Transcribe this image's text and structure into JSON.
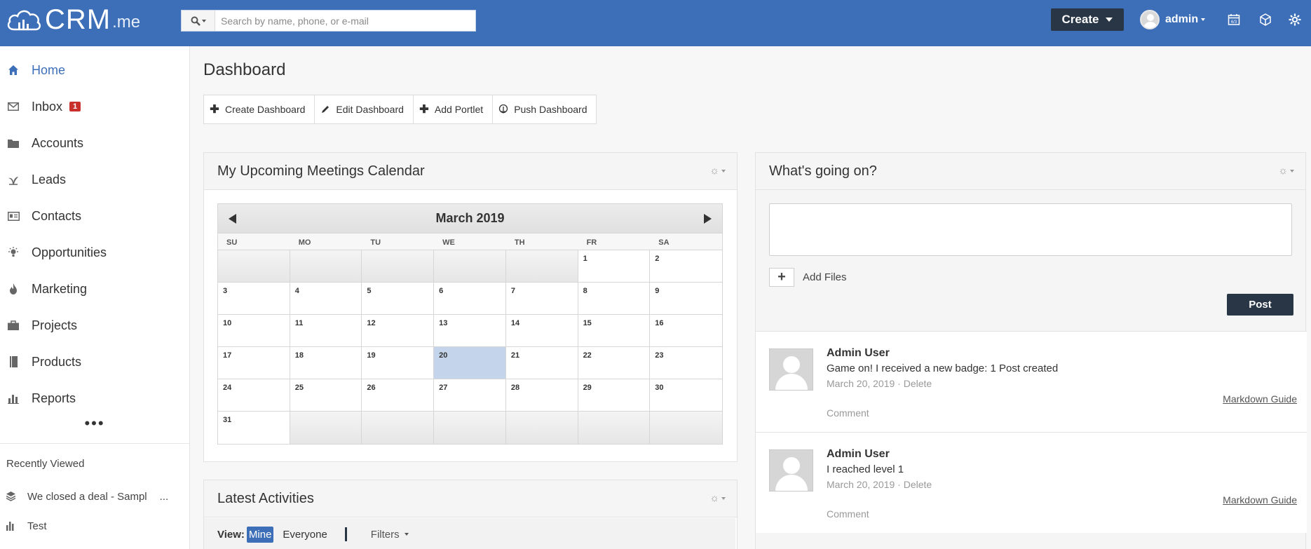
{
  "header": {
    "logo_text": "CRM",
    "logo_suffix": ".me",
    "search_placeholder": "Search by name, phone, or e-mail",
    "create_label": "Create",
    "user_name": "admin",
    "calendar_icon_text": "6/3",
    "accent_color": "#3d6fb8",
    "dark_color": "#283646"
  },
  "sidebar": {
    "items": [
      {
        "label": "Home",
        "icon": "home-icon",
        "active": true
      },
      {
        "label": "Inbox",
        "icon": "envelope-icon",
        "badge": "1"
      },
      {
        "label": "Accounts",
        "icon": "folder-icon"
      },
      {
        "label": "Leads",
        "icon": "seedling-icon"
      },
      {
        "label": "Contacts",
        "icon": "id-card-icon"
      },
      {
        "label": "Opportunities",
        "icon": "lightbulb-icon"
      },
      {
        "label": "Marketing",
        "icon": "flame-icon"
      },
      {
        "label": "Projects",
        "icon": "briefcase-icon"
      },
      {
        "label": "Products",
        "icon": "book-icon"
      },
      {
        "label": "Reports",
        "icon": "bar-chart-icon"
      }
    ],
    "more": "•••",
    "recent_title": "Recently Viewed",
    "recent": [
      {
        "label": "We closed a deal - Sampl",
        "ellipsis": "...",
        "icon": "layers-icon"
      },
      {
        "label": "Test",
        "icon": "bar-chart-icon"
      }
    ]
  },
  "main": {
    "title": "Dashboard",
    "toolbar": {
      "create": "Create Dashboard",
      "edit": "Edit Dashboard",
      "add_portlet": "Add Portlet",
      "push": "Push Dashboard"
    },
    "calendar": {
      "title": "My Upcoming Meetings Calendar",
      "month": "March 2019",
      "days_of_week": [
        "SU",
        "MO",
        "TU",
        "WE",
        "TH",
        "FR",
        "SA"
      ],
      "weeks": [
        [
          "",
          "",
          "",
          "",
          "",
          "1",
          "2"
        ],
        [
          "3",
          "4",
          "5",
          "6",
          "7",
          "8",
          "9"
        ],
        [
          "10",
          "11",
          "12",
          "13",
          "14",
          "15",
          "16"
        ],
        [
          "17",
          "18",
          "19",
          "20",
          "21",
          "22",
          "23"
        ],
        [
          "24",
          "25",
          "26",
          "27",
          "28",
          "29",
          "30"
        ],
        [
          "31",
          "",
          "",
          "",
          "",
          "",
          ""
        ]
      ],
      "today": "20"
    },
    "activities": {
      "title": "Latest Activities",
      "view_label": "View:",
      "mine": "Mine",
      "everyone": "Everyone",
      "filters": "Filters"
    },
    "whats_going_on": {
      "title": "What's going on?",
      "add_files": "Add Files",
      "post": "Post",
      "feed": [
        {
          "name": "Admin User",
          "text": "Game on! I received a new badge: 1 Post created",
          "date": "March 20, 2019",
          "separator": " · ",
          "delete": "Delete",
          "comment": "Comment",
          "markdown": "Markdown Guide"
        },
        {
          "name": "Admin User",
          "text": "I reached level 1",
          "date": "March 20, 2019",
          "separator": " · ",
          "delete": "Delete",
          "comment": "Comment",
          "markdown": "Markdown Guide"
        }
      ]
    }
  }
}
